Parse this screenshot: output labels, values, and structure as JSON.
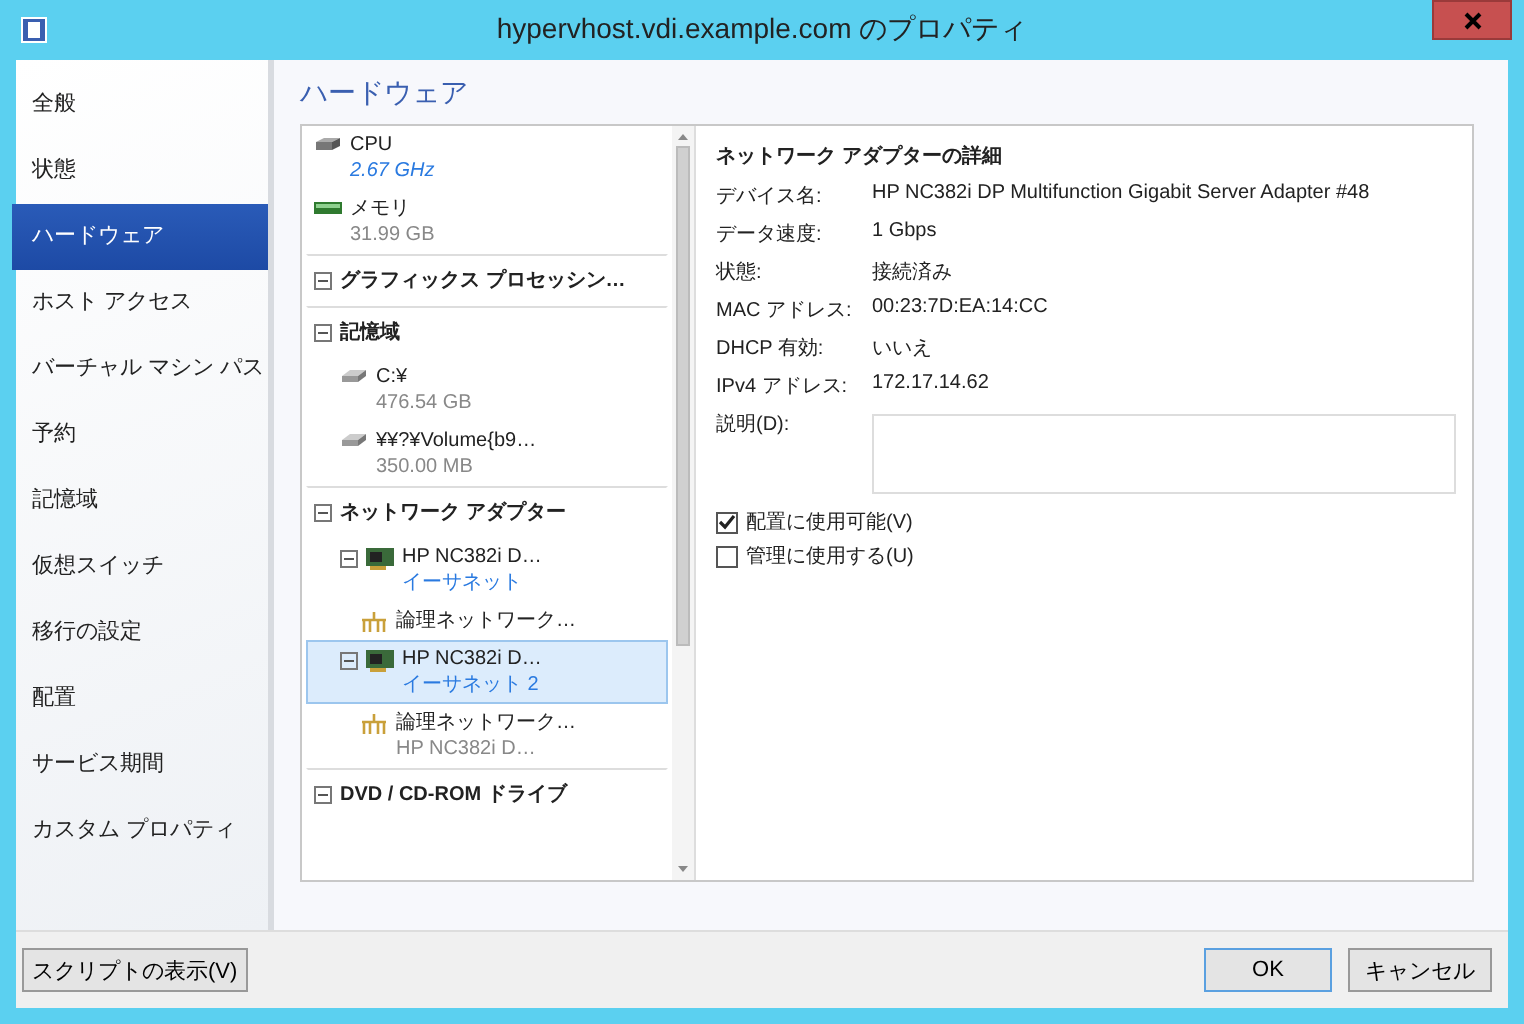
{
  "window": {
    "title": "hypervhost.vdi.example.com のプロパティ"
  },
  "sidebar": {
    "items": [
      {
        "label": "全般",
        "selected": false
      },
      {
        "label": "状態",
        "selected": false
      },
      {
        "label": "ハードウェア",
        "selected": true
      },
      {
        "label": "ホスト アクセス",
        "selected": false
      },
      {
        "label": "バーチャル マシン パス",
        "selected": false
      },
      {
        "label": "予約",
        "selected": false
      },
      {
        "label": "記憶域",
        "selected": false
      },
      {
        "label": "仮想スイッチ",
        "selected": false
      },
      {
        "label": "移行の設定",
        "selected": false
      },
      {
        "label": "配置",
        "selected": false
      },
      {
        "label": "サービス期間",
        "selected": false
      },
      {
        "label": "カスタム プロパティ",
        "selected": false
      }
    ]
  },
  "section_title": "ハードウェア",
  "tree": {
    "items": [
      {
        "kind": "cpu",
        "label": "CPU",
        "value": "2.67 GHz",
        "selected": false
      },
      {
        "kind": "memory",
        "label": "メモリ",
        "value": "31.99 GB",
        "selected": false
      },
      {
        "kind": "group",
        "label": "グラフィックス プロセッシン…",
        "expanded": true,
        "selected": false
      },
      {
        "kind": "group",
        "label": "記憶域",
        "expanded": true,
        "selected": false
      },
      {
        "kind": "disk",
        "label": "C:¥",
        "value": "476.54 GB",
        "selected": false
      },
      {
        "kind": "disk",
        "label": "¥¥?¥Volume{b9…",
        "value": "350.00 MB",
        "selected": false
      },
      {
        "kind": "group",
        "label": "ネットワーク アダプター",
        "expanded": true,
        "selected": false
      },
      {
        "kind": "adapter",
        "label": "HP NC382i D…",
        "link": "イーサネット",
        "expanded": true,
        "selected": false
      },
      {
        "kind": "logical",
        "label": "論理ネットワーク…",
        "selected": false
      },
      {
        "kind": "adapter",
        "label": "HP NC382i D…",
        "link": "イーサネット 2",
        "expanded": true,
        "selected": true
      },
      {
        "kind": "logical",
        "label": "論理ネットワーク…",
        "value": "HP NC382i D…",
        "selected": false
      },
      {
        "kind": "group",
        "label": "DVD / CD-ROM ドライブ",
        "expanded": true,
        "selected": false
      }
    ]
  },
  "details": {
    "title": "ネットワーク アダプターの詳細",
    "fields": [
      {
        "label": "デバイス名:",
        "value": "HP NC382i DP Multifunction Gigabit Server Adapter #48"
      },
      {
        "label": "データ速度:",
        "value": "1 Gbps"
      },
      {
        "label": "状態:",
        "value": "接続済み"
      },
      {
        "label": "MAC アドレス:",
        "value": "00:23:7D:EA:14:CC"
      },
      {
        "label": "DHCP 有効:",
        "value": "いいえ"
      },
      {
        "label": "IPv4 アドレス:",
        "value": "172.17.14.62"
      }
    ],
    "description_label": "説明(D):",
    "checkboxes": [
      {
        "label": "配置に使用可能(V)",
        "checked": true
      },
      {
        "label": "管理に使用する(U)",
        "checked": false
      }
    ]
  },
  "buttons": {
    "script": "スクリプトの表示(V)",
    "ok": "OK",
    "cancel": "キャンセル"
  }
}
